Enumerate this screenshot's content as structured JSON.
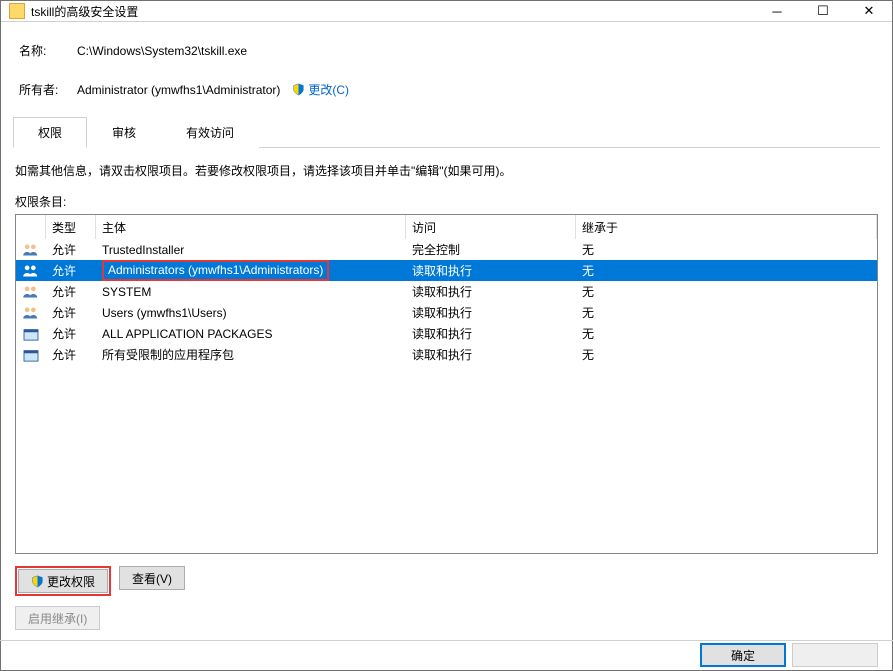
{
  "window": {
    "title": "tskill的高级安全设置"
  },
  "info": {
    "name_label": "名称:",
    "name_value": "C:\\Windows\\System32\\tskill.exe",
    "owner_label": "所有者:",
    "owner_value": "Administrator (ymwfhs1\\Administrator)",
    "change_link": "更改(C)"
  },
  "tabs": {
    "permissions": "权限",
    "auditing": "审核",
    "effective": "有效访问"
  },
  "instruction": "如需其他信息，请双击权限项目。若要修改权限项目，请选择该项目并单击\"编辑\"(如果可用)。",
  "list_label": "权限条目:",
  "columns": {
    "type": "类型",
    "principal": "主体",
    "access": "访问",
    "inherit": "继承于"
  },
  "rows": [
    {
      "icon": "group",
      "type": "允许",
      "principal": "TrustedInstaller",
      "access": "完全控制",
      "inherit": "无",
      "selected": false,
      "highlight": false
    },
    {
      "icon": "group",
      "type": "允许",
      "principal": "Administrators (ymwfhs1\\Administrators)",
      "access": "读取和执行",
      "inherit": "无",
      "selected": true,
      "highlight": true
    },
    {
      "icon": "group",
      "type": "允许",
      "principal": "SYSTEM",
      "access": "读取和执行",
      "inherit": "无",
      "selected": false,
      "highlight": false
    },
    {
      "icon": "group",
      "type": "允许",
      "principal": "Users (ymwfhs1\\Users)",
      "access": "读取和执行",
      "inherit": "无",
      "selected": false,
      "highlight": false
    },
    {
      "icon": "pkg",
      "type": "允许",
      "principal": "ALL APPLICATION PACKAGES",
      "access": "读取和执行",
      "inherit": "无",
      "selected": false,
      "highlight": false
    },
    {
      "icon": "pkg",
      "type": "允许",
      "principal": "所有受限制的应用程序包",
      "access": "读取和执行",
      "inherit": "无",
      "selected": false,
      "highlight": false
    }
  ],
  "buttons": {
    "change_perm": "更改权限",
    "view": "查看(V)",
    "enable_inherit": "启用继承(I)",
    "ok": "确定"
  }
}
